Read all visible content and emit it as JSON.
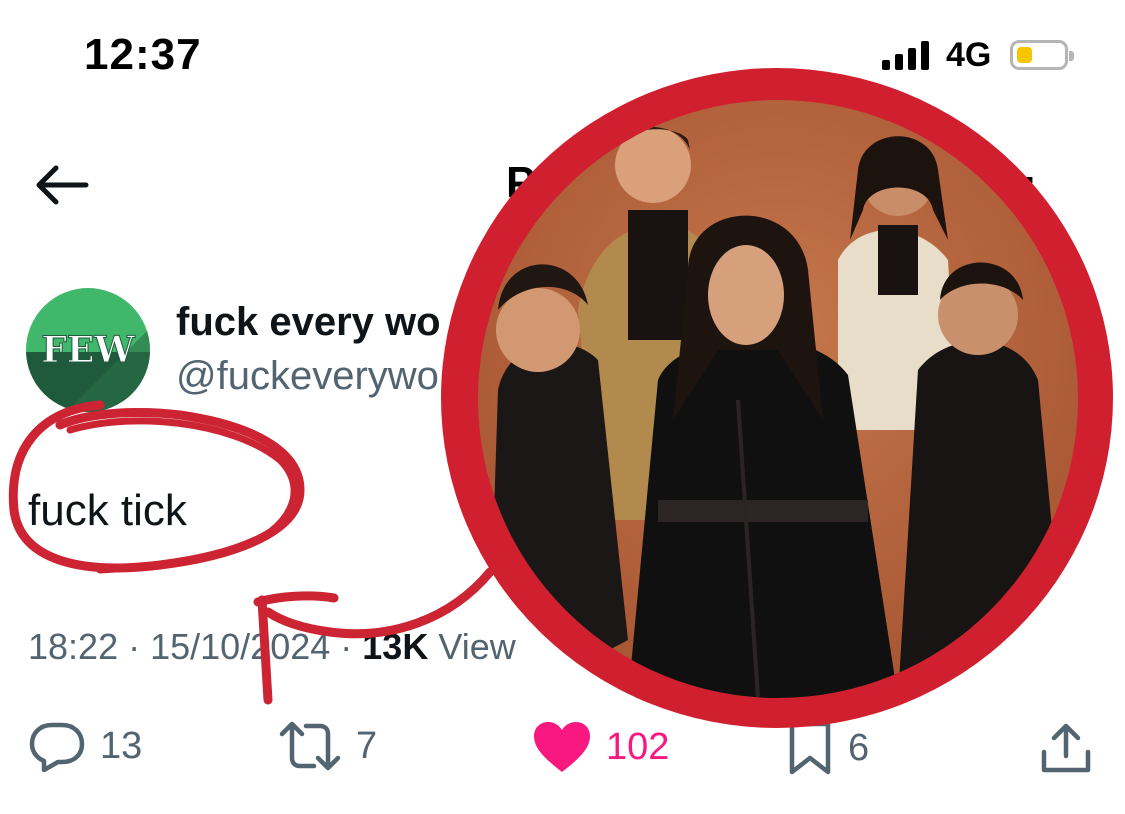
{
  "status_bar": {
    "time": "12:37",
    "network": "4G",
    "battery_level": 0.35,
    "battery_color": "#f7c600"
  },
  "nav": {
    "back_icon": "arrow-left-icon",
    "title_partial": "P",
    "more_partial": ":"
  },
  "author": {
    "avatar_text": "FEW",
    "avatar_colors": {
      "top": "#41b76b",
      "bottom": "#1f5a3c"
    },
    "display_name": "fuck every wo",
    "handle": "@fuckeverywo"
  },
  "tweet": {
    "text": "fuck tick",
    "time": "18:22",
    "date": "15/10/2024",
    "separator": " · ",
    "views_count": "13K",
    "views_label": "View"
  },
  "actions": {
    "replies": "13",
    "retweets": "7",
    "likes": "102",
    "bookmarks": "6",
    "like_color": "#f91880",
    "icon_color": "#536471"
  },
  "overlay": {
    "ring_color": "#d01f2e",
    "content": "band-photo"
  }
}
